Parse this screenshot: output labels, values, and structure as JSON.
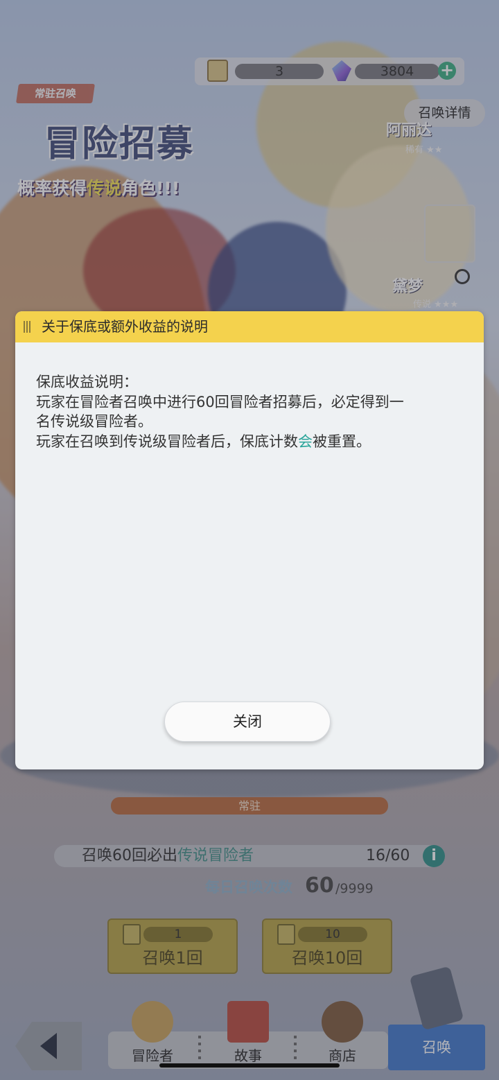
{
  "currency": {
    "ticket_count": "3",
    "gem_count": "3804",
    "add_symbol": "+"
  },
  "banner": {
    "tag": "常驻召唤",
    "title": "冒险招募",
    "subtitle_prefix": "概率获得",
    "subtitle_legend": "传说",
    "subtitle_suffix": "角色!!!",
    "detail_button": "召唤详情",
    "characters": [
      {
        "name": "阿丽达",
        "rarity": "稀有 ★★"
      },
      {
        "name": "黛梦",
        "rarity": "传说 ★★★"
      }
    ]
  },
  "modal": {
    "title": "关于保底或额外收益的说明",
    "body_lines": [
      "保底收益说明：",
      "玩家在冒险者召唤中进行60回冒险者招募后，必定得到一",
      "名传说级冒险者。"
    ],
    "last_line_pre": "玩家在召唤到传说级冒险者后，保底计数",
    "last_line_highlight": "会",
    "last_line_post": "被重置。",
    "close_label": "关闭"
  },
  "summon_panel": {
    "pool_label": "常驻",
    "pity_prefix": "召唤60回必出",
    "pity_legend": "传说冒险者",
    "pity_count": "16/60",
    "info_symbol": "i",
    "daily_label": "每日召唤次数",
    "daily_value": "60",
    "daily_max": "/9999",
    "single": {
      "count": "1",
      "label": "召唤1回"
    },
    "multi": {
      "count": "10",
      "label": "召唤10回"
    }
  },
  "nav": {
    "adventurer": "冒险者",
    "story": "故事",
    "shop": "商店",
    "summon": "召唤"
  },
  "colors": {
    "modal_header": "#f4d24d",
    "accent_teal": "#2aa59a",
    "summon_active": "#3f78cc"
  }
}
